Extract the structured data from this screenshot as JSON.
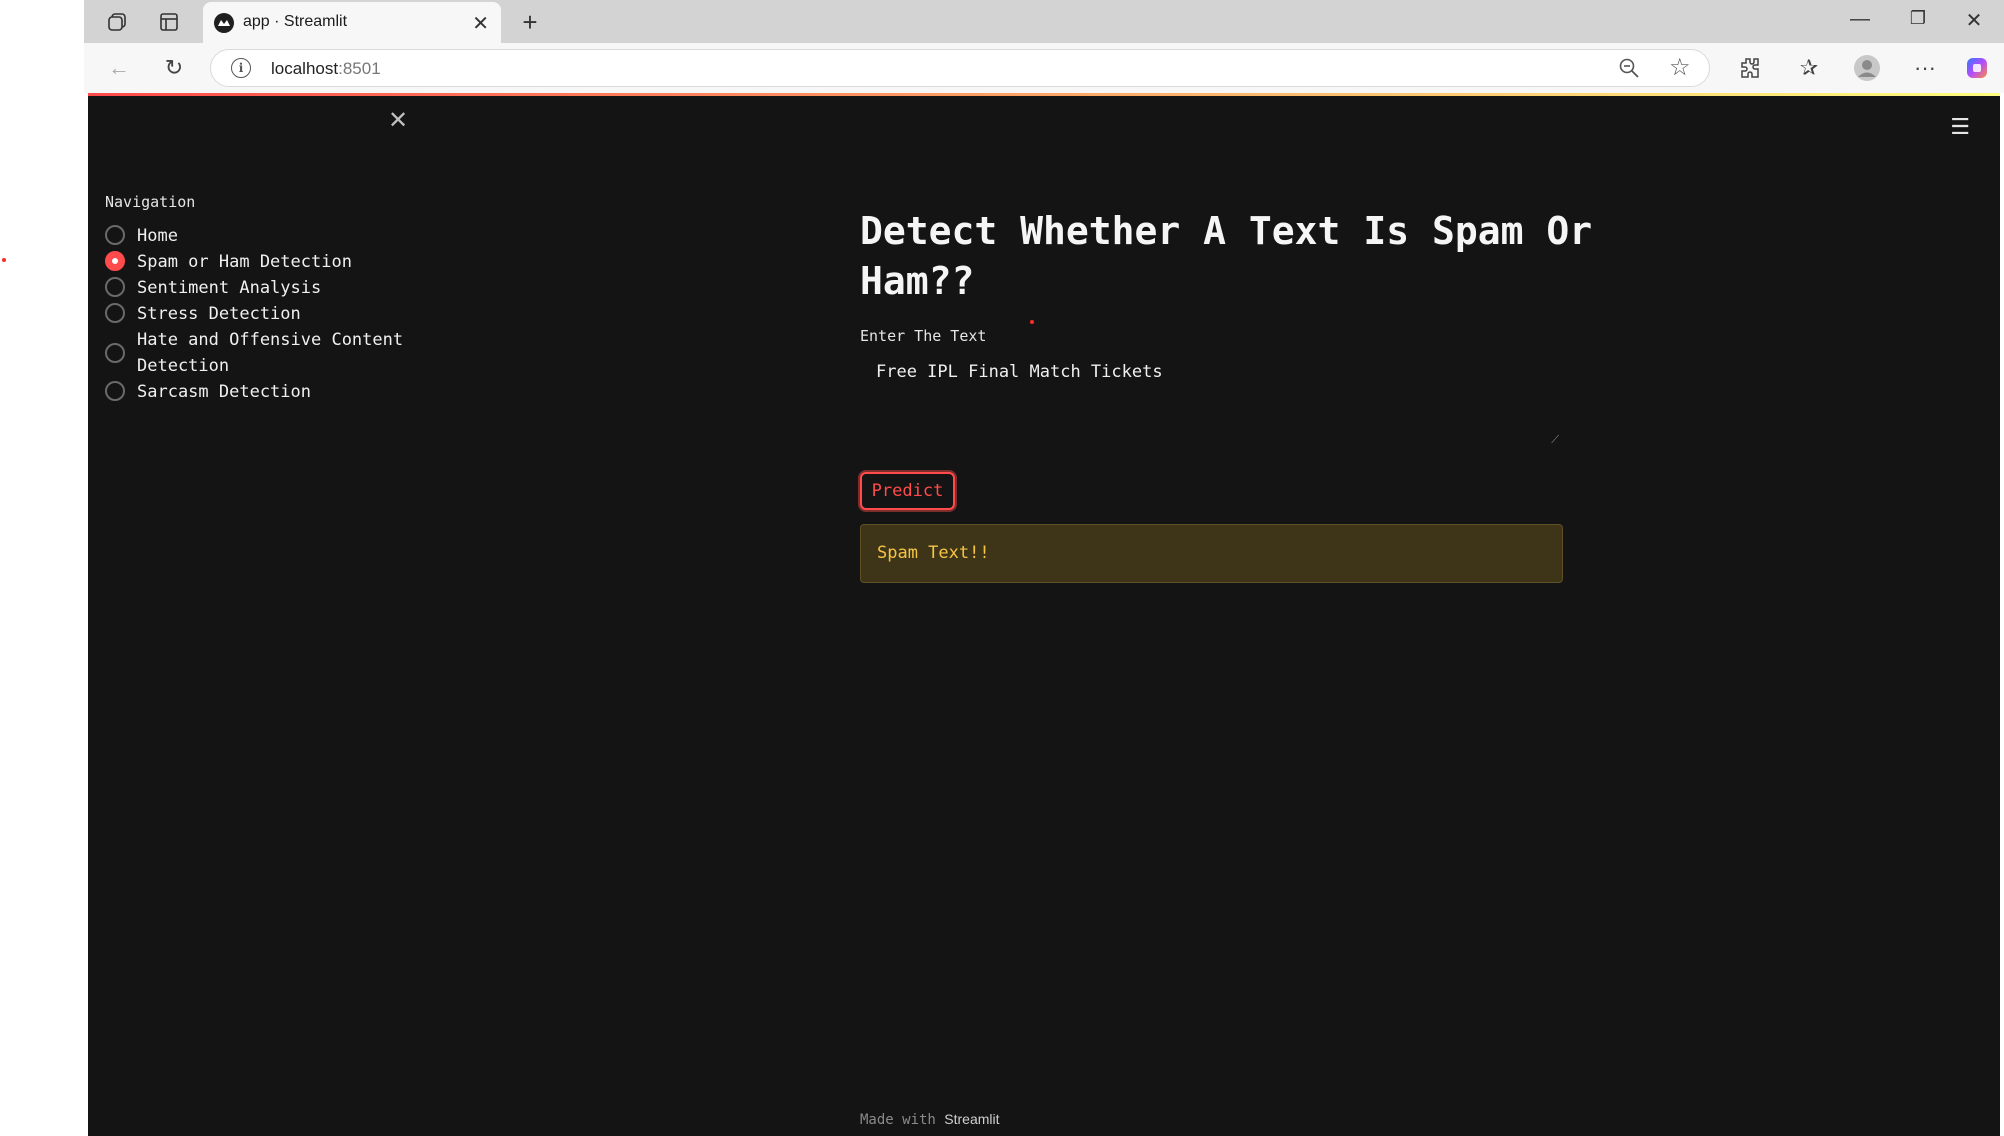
{
  "browser": {
    "tab_title": "app · Streamlit",
    "address_host": "localhost",
    "address_port": ":8501",
    "colors": {
      "accent": "#ff4b4b"
    }
  },
  "sidebar": {
    "nav_title": "Navigation",
    "items": [
      {
        "label": "Home",
        "selected": false
      },
      {
        "label": "Spam or Ham Detection",
        "selected": true
      },
      {
        "label": "Sentiment Analysis",
        "selected": false
      },
      {
        "label": "Stress Detection",
        "selected": false
      },
      {
        "label": "Hate and Offensive Content Detection",
        "selected": false
      },
      {
        "label": "Sarcasm Detection",
        "selected": false
      }
    ]
  },
  "main": {
    "title": "Detect Whether A Text Is Spam Or Ham??",
    "input_label": "Enter The Text",
    "input_value": "Free IPL Final Match Tickets",
    "predict_label": "Predict",
    "result": "Spam Text!!",
    "result_color": "#f7c544"
  },
  "footer": {
    "prefix": "Made with",
    "brand": "Streamlit"
  }
}
